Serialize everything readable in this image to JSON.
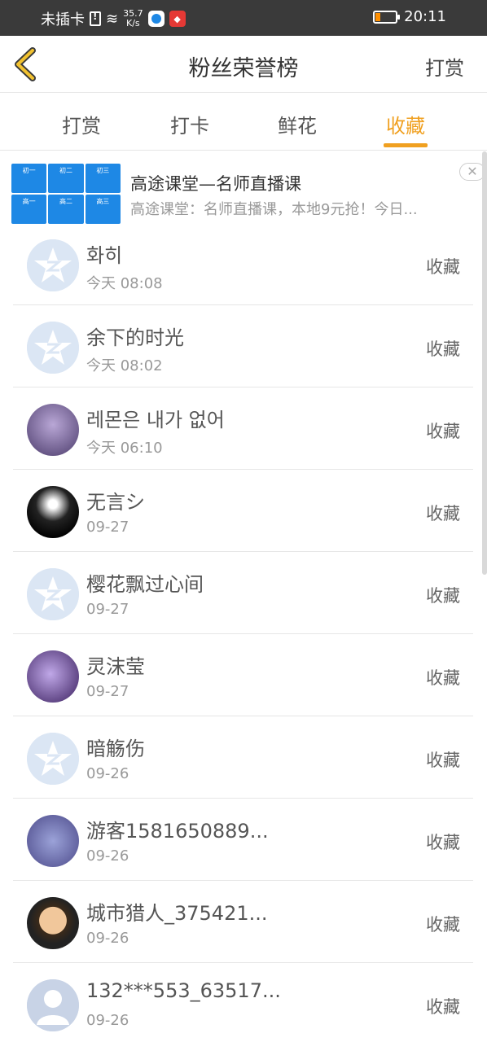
{
  "status_bar": {
    "carrier": "未插卡",
    "speed_value": "35.7",
    "speed_unit": "K/s",
    "app_icon_text": "",
    "time": "20:11",
    "battery_level": 0.25
  },
  "header": {
    "title": "粉丝荣誉榜",
    "action_label": "打赏"
  },
  "tabs": [
    {
      "label": "打赏"
    },
    {
      "label": "打卡"
    },
    {
      "label": "鲜花"
    },
    {
      "label": "收藏"
    }
  ],
  "active_tab": "收藏",
  "ad": {
    "title": "高途课堂—名师直播课",
    "description": "高途课堂：名师直播课，本地9元抢！今日...",
    "thumb_cells": [
      "初一",
      "初二",
      "初三",
      "高一",
      "高二",
      "高三"
    ],
    "close_glyph": "✕"
  },
  "list": [
    {
      "name": "화히",
      "time": "今天 08:08",
      "action": "收藏",
      "avatar": "default"
    },
    {
      "name": "余下的时光",
      "time": "今天 08:02",
      "action": "收藏",
      "avatar": "default"
    },
    {
      "name": "레몬은 내가 없어",
      "time": "今天 06:10",
      "action": "收藏",
      "avatar": "photo1"
    },
    {
      "name": "无言シ",
      "time": "09-27",
      "action": "收藏",
      "avatar": "photo2"
    },
    {
      "name": "樱花飘过心间",
      "time": "09-27",
      "action": "收藏",
      "avatar": "default"
    },
    {
      "name": "灵沫莹",
      "time": "09-27",
      "action": "收藏",
      "avatar": "photo3"
    },
    {
      "name": "暗觞伤",
      "time": "09-26",
      "action": "收藏",
      "avatar": "default"
    },
    {
      "name": "游客1581650889...",
      "time": "09-26",
      "action": "收藏",
      "avatar": "photo4"
    },
    {
      "name": "城市猎人_375421...",
      "time": "09-26",
      "action": "收藏",
      "avatar": "photo5"
    },
    {
      "name": "132***553_63517...",
      "time": "09-26",
      "action": "收藏",
      "avatar": "person"
    }
  ]
}
